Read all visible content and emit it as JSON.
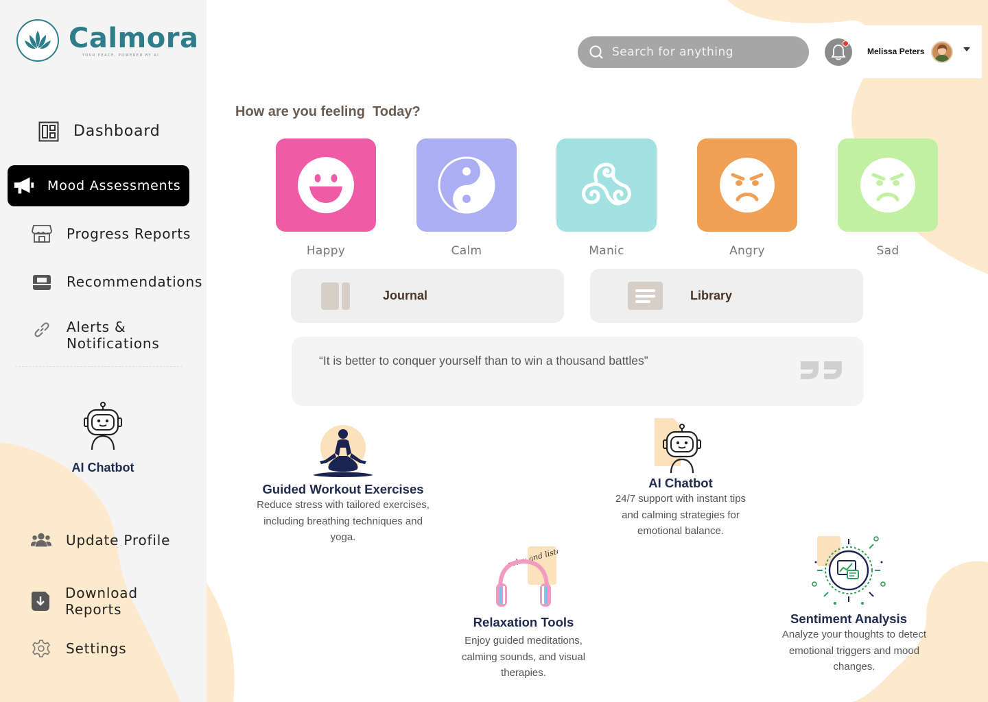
{
  "app": {
    "name": "Calmora",
    "tagline": "YOUR PEACE, POWERED BY AI"
  },
  "sidebar": {
    "items": [
      {
        "label": "Dashboard",
        "icon": "dashboard-icon"
      },
      {
        "label": "Mood Assessments",
        "icon": "megaphone-icon",
        "active": true
      },
      {
        "label": "Progress Reports",
        "icon": "store-icon"
      },
      {
        "label": "Recommendations",
        "icon": "inbox-icon"
      },
      {
        "label": "Alerts & Notifications",
        "icon": "link-icon"
      },
      {
        "label": "Update Profile",
        "icon": "users-icon"
      },
      {
        "label": "Download Reports",
        "icon": "download-icon"
      },
      {
        "label": "Settings",
        "icon": "gear-icon"
      }
    ],
    "chatbot_label": "AI Chatbot"
  },
  "header": {
    "search_placeholder": "Search for anything",
    "user_name": "Melissa Peters"
  },
  "mood": {
    "heading": "How are you feeling  Today?",
    "options": [
      {
        "label": "Happy",
        "color": "#ef5ba7",
        "icon": "happy-face-icon"
      },
      {
        "label": "Calm",
        "color": "#acaef3",
        "icon": "yin-yang-icon"
      },
      {
        "label": "Manic",
        "color": "#a1e2e1",
        "icon": "triple-spiral-icon"
      },
      {
        "label": "Angry",
        "color": "#f0a055",
        "icon": "angry-face-icon"
      },
      {
        "label": "Sad",
        "color": "#c1f0a0",
        "icon": "sad-face-icon"
      }
    ]
  },
  "cards": {
    "journal": "Journal",
    "library": "Library"
  },
  "quote": "“It is better to conquer yourself than to win a thousand battles”",
  "features": [
    {
      "title": "Guided Workout Exercises",
      "desc": [
        "Reduce stress with tailored exercises,",
        "including breathing techniques and",
        "yoga."
      ]
    },
    {
      "title": "AI Chatbot",
      "desc": [
        "24/7 support with instant tips",
        "and calming strategies for",
        "emotional balance."
      ]
    },
    {
      "title": "Relaxation Tools",
      "desc": [
        "Enjoy guided meditations,",
        "calming sounds, and visual",
        "therapies."
      ]
    },
    {
      "title": "Sentiment Analysis",
      "desc": [
        "Analyze your thoughts to detect",
        "emotional triggers and mood",
        "changes."
      ]
    }
  ],
  "colors": {
    "brand": "#2e7d8a",
    "accent_blob": "#fde9cc",
    "active_nav": "#000000"
  }
}
